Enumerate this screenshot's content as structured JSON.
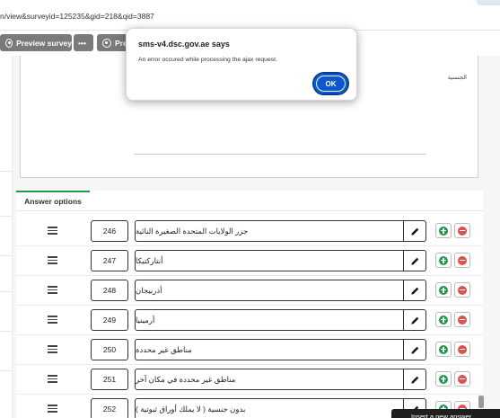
{
  "browser": {
    "url": "n/view&surveyid=125235&gid=218&qid=3887"
  },
  "toolbar": {
    "preview_survey": "Preview survey",
    "more": "•••",
    "preview_truncated": "Pre"
  },
  "editor": {
    "text": "الجنسية"
  },
  "tabs": {
    "answer_options": "Answer options"
  },
  "rows": [
    {
      "code": "246",
      "answer": "جزر الولايات المتحدة الصغيرة النائية"
    },
    {
      "code": "247",
      "answer": "أنتاركتيكا"
    },
    {
      "code": "248",
      "answer": "أذربيجان"
    },
    {
      "code": "249",
      "answer": "أرمينيا"
    },
    {
      "code": "250",
      "answer": "مناطق غير محددة"
    },
    {
      "code": "251",
      "answer": "مناطق غير محددة في مكان آخر"
    },
    {
      "code": "252",
      "answer": "بدون جنسية ( لا يملك أوراق ثبوتية )"
    }
  ],
  "tooltip": {
    "text": "Insert a new answer"
  },
  "dialog": {
    "title": "sms-v4.dsc.gov.ae says",
    "message": "An error occured while processing the ajax request.",
    "ok": "OK"
  },
  "icons": {
    "drag": "drag-handle-icon",
    "edit": "pencil-icon",
    "add": "plus-circle-icon",
    "remove": "minus-circle-icon",
    "preview": "eye-icon"
  },
  "colors": {
    "add": "#1f9a4c",
    "remove": "#d9534f",
    "ok_button": "#0b57d0",
    "toolbar_button": "#7a7a7a",
    "tab_accent": "#1f9a4c"
  }
}
